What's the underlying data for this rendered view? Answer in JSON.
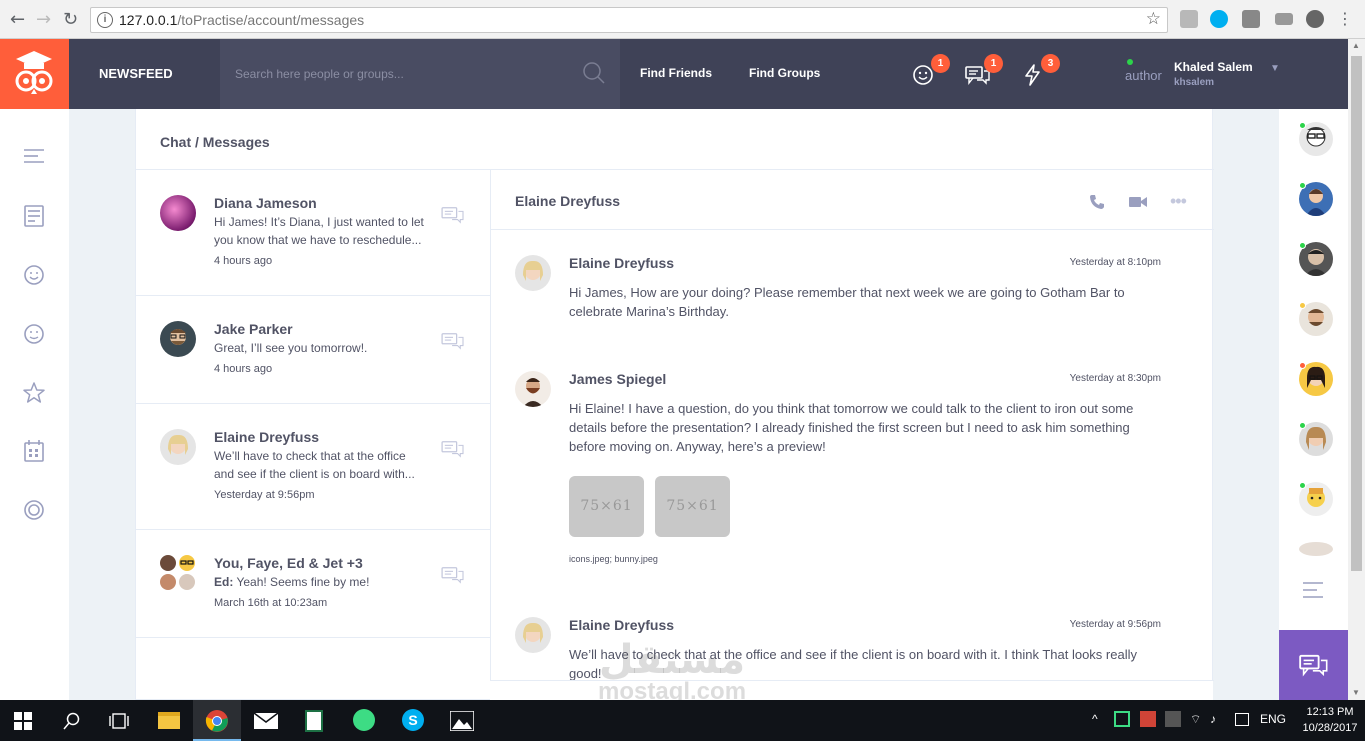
{
  "browser": {
    "url_host": "127.0.0.1",
    "url_path": "/toPractise/account/messages"
  },
  "header": {
    "brand_label": "NEWSFEED",
    "search_placeholder": "Search here people or groups...",
    "links": [
      "Find Friends",
      "Find Groups"
    ],
    "badges": {
      "friend_requests": "1",
      "messages": "1",
      "notifications": "3"
    },
    "user": {
      "role": "author",
      "name": "Khaled Salem",
      "handle": "khsalem"
    }
  },
  "panel": {
    "title": "Chat / Messages"
  },
  "conversations": [
    {
      "name": "Diana Jameson",
      "text": "Hi James! It’s Diana, I just wanted to let you know that we have to reschedule...",
      "time": "4 hours ago"
    },
    {
      "name": "Jake Parker",
      "text": "Great, I’ll see you tomorrow!.",
      "time": "4 hours ago"
    },
    {
      "name": "Elaine Dreyfuss",
      "text": "We’ll have to check that at the office and see if the client is on board with...",
      "time": "Yesterday at 9:56pm"
    },
    {
      "name": "You, Faye, Ed & Jet +3",
      "sender": "Ed:",
      "text": "Yeah! Seems fine by me!",
      "time": "March 16th at 10:23am"
    }
  ],
  "thread": {
    "title": "Elaine Dreyfuss",
    "messages": [
      {
        "name": "Elaine Dreyfuss",
        "time": "Yesterday at 8:10pm",
        "text": "Hi James, How are your doing? Please remember that next week we are going to Gotham Bar to celebrate Marina’s Birthday."
      },
      {
        "name": "James Spiegel",
        "time": "Yesterday at 8:30pm",
        "text": "Hi Elaine! I have a question, do you think that tomorrow we could talk to the client to iron out some details before the presentation? I already finished the first screen but I need to ask him something before moving on. Anyway, here’s a preview!",
        "attachments": [
          "75×61",
          "75×61"
        ],
        "filenames": "icons.jpeg; bunny.jpeg"
      },
      {
        "name": "Elaine Dreyfuss",
        "time": "Yesterday at 9:56pm",
        "text": "We’ll have to check that at the office and see if the client is on board with it. I think That looks really good!"
      }
    ]
  },
  "taskbar": {
    "lang": "ENG",
    "time": "12:13 PM",
    "date": "10/28/2017"
  },
  "watermark": {
    "arabic": "مستقل",
    "latin": "mostaql.com"
  },
  "colors": {
    "accent_orange": "#ff5e3a",
    "header_bg": "#3f4257",
    "purple": "#7c5ac2",
    "online_green": "#2cd34a"
  }
}
